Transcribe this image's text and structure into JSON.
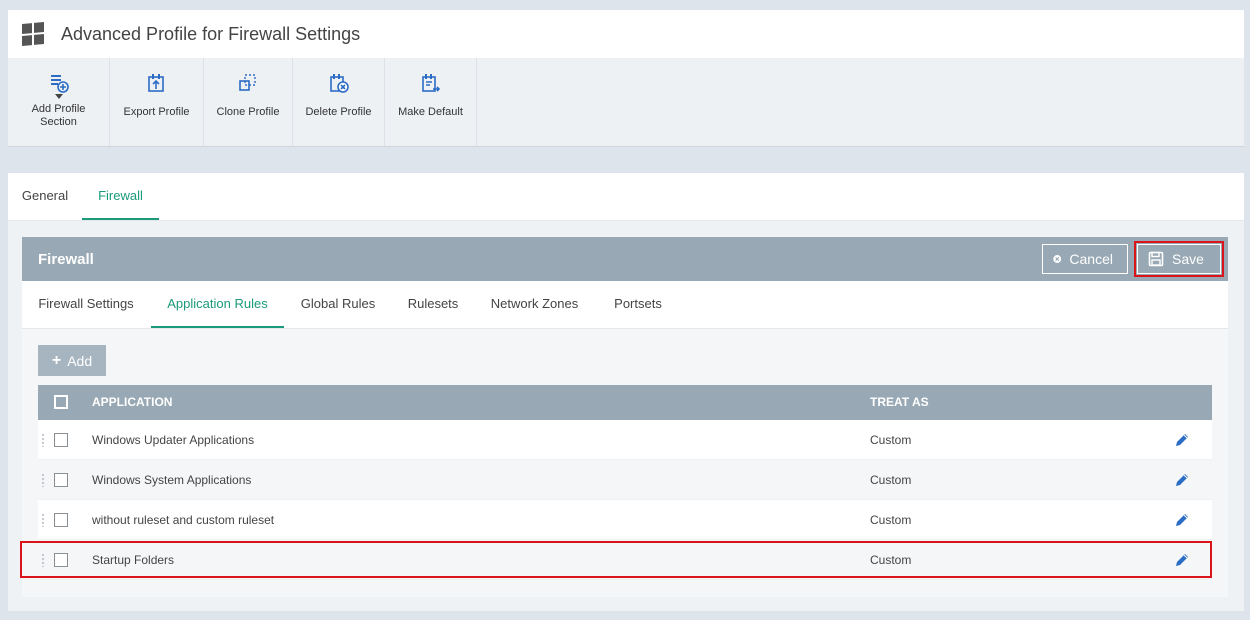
{
  "window": {
    "title": "Advanced Profile for Firewall Settings"
  },
  "toolbar": {
    "items": [
      {
        "label": "Add Profile\nSection",
        "icon": "add-section-icon",
        "has_dropdown": true
      },
      {
        "label": "Export Profile",
        "icon": "export-icon"
      },
      {
        "label": "Clone Profile",
        "icon": "clone-icon"
      },
      {
        "label": "Delete Profile",
        "icon": "delete-icon"
      },
      {
        "label": "Make Default",
        "icon": "make-default-icon"
      }
    ]
  },
  "main_tabs": [
    {
      "label": "General",
      "active": false
    },
    {
      "label": "Firewall",
      "active": true
    }
  ],
  "panel": {
    "title": "Firewall",
    "cancel_label": "Cancel",
    "save_label": "Save"
  },
  "sub_tabs": [
    {
      "label": "Firewall Settings",
      "active": false
    },
    {
      "label": "Application Rules",
      "active": true
    },
    {
      "label": "Global Rules",
      "active": false
    },
    {
      "label": "Rulesets",
      "active": false
    },
    {
      "label": "Network Zones",
      "active": false
    },
    {
      "label": "Portsets",
      "active": false
    }
  ],
  "add_label": "Add",
  "table": {
    "columns": [
      "APPLICATION",
      "TREAT AS"
    ],
    "rows": [
      {
        "application": "Windows Updater Applications",
        "treat_as": "Custom"
      },
      {
        "application": "Windows System Applications",
        "treat_as": "Custom"
      },
      {
        "application": "without ruleset and custom ruleset",
        "treat_as": "Custom"
      },
      {
        "application": "Startup Folders",
        "treat_as": "Custom"
      }
    ]
  },
  "colors": {
    "accent": "#1a9a7a",
    "panel_header": "#98a8b4",
    "highlight": "#d9141b",
    "edit_icon": "#2b6cc4"
  }
}
